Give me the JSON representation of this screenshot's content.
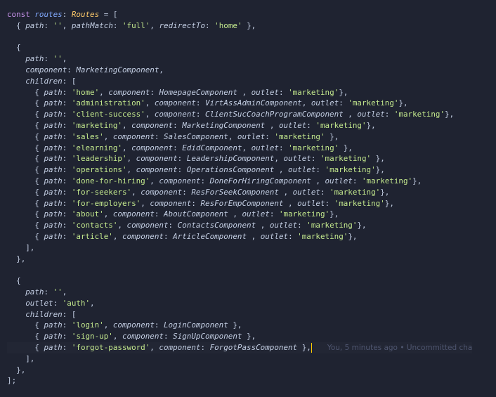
{
  "editor": {
    "theme_colors": {
      "background": "#1f2331",
      "keyword": "#c792ea",
      "variable": "#82aaff",
      "type": "#ffcb6b",
      "string": "#c3e88d",
      "punctuation": "#89ddff",
      "text": "#c3cee3"
    },
    "blame_text": "You, 5 minutes ago • Uncommitted cha",
    "lines": [
      "const routes: Routes = [",
      "  { path: '', pathMatch: 'full', redirectTo: 'home' },",
      "",
      "  {",
      "    path: '',",
      "    component: MarketingComponent,",
      "    children: [",
      "      { path: 'home', component: HomepageComponent , outlet: 'marketing'},",
      "      { path: 'administration', component: VirtAssAdminComponent, outlet: 'marketing'},",
      "      { path: 'client-success', component: ClientSucCoachProgramComponent , outlet: 'marketing'},",
      "      { path: 'marketing', component: MarketingComponent , outlet: 'marketing'},",
      "      { path: 'sales', component: SalesComponent, outlet: 'marketing' },",
      "      { path: 'elearning', component: EdidComponent, outlet: 'marketing' },",
      "      { path: 'leadership', component: LeadershipComponent, outlet: 'marketing' },",
      "      { path: 'operations', component: OperationsComponent , outlet: 'marketing'},",
      "      { path: 'done-for-hiring', component: DoneForHiringComponent , outlet: 'marketing'},",
      "      { path: 'for-seekers', component: ResForSeekComponent , outlet: 'marketing'},",
      "      { path: 'for-employers', component: ResForEmpComponent , outlet: 'marketing'},",
      "      { path: 'about', component: AboutComponent , outlet: 'marketing'},",
      "      { path: 'contacts', component: ContactsComponent , outlet: 'marketing'},",
      "      { path: 'article', component: ArticleComponent , outlet: 'marketing'},",
      "    ],",
      "  },",
      "",
      "  {",
      "    path: '',",
      "    outlet: 'auth',",
      "    children: [",
      "      { path: 'login', component: LoginComponent },",
      "      { path: 'sign-up', component: SignUpComponent },",
      "      { path: 'forgot-password', component: ForgotPassComponent },",
      "    ],",
      "  },",
      "];"
    ]
  }
}
